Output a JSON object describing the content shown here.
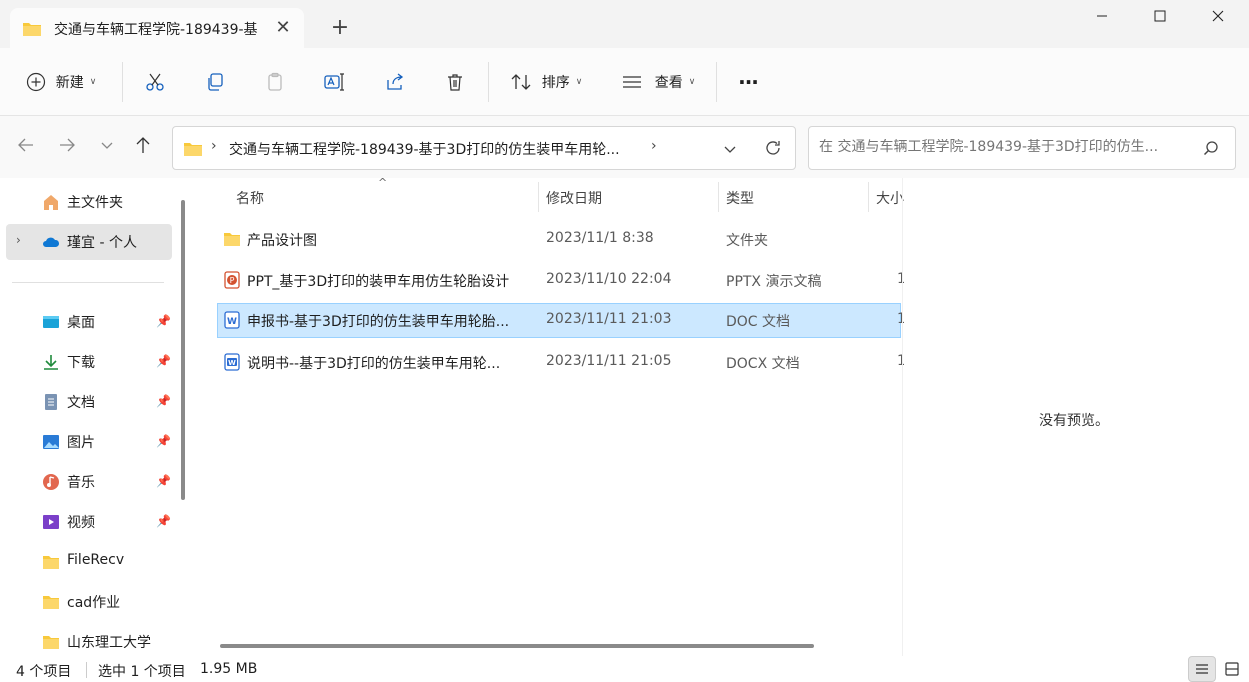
{
  "tab": {
    "title": "交通与车辆工程学院-189439-基",
    "close": "✕",
    "new_tab": "+"
  },
  "window": {
    "minimize": "—",
    "maximize": "☐",
    "close": "✕"
  },
  "toolbar": {
    "new_label": "新建",
    "sort_label": "排序",
    "view_label": "查看",
    "more_label": "···"
  },
  "address": {
    "path": "交通与车辆工程学院-189439-基于3D打印的仿生装甲车用轮...",
    "search_placeholder": "在 交通与车辆工程学院-189439-基于3D打印的仿生..."
  },
  "sidebar": {
    "items": [
      {
        "label": "主文件夹",
        "icon": "home-icon"
      },
      {
        "label": "瑾宜 - 个人",
        "icon": "onedrive-icon"
      },
      {
        "label": "桌面",
        "icon": "desktop-icon",
        "pinned": true
      },
      {
        "label": "下载",
        "icon": "download-icon",
        "pinned": true
      },
      {
        "label": "文档",
        "icon": "document-icon",
        "pinned": true
      },
      {
        "label": "图片",
        "icon": "pictures-icon",
        "pinned": true
      },
      {
        "label": "音乐",
        "icon": "music-icon",
        "pinned": true
      },
      {
        "label": "视频",
        "icon": "video-icon",
        "pinned": true
      },
      {
        "label": "FileRecv",
        "icon": "folder-icon"
      },
      {
        "label": "cad作业",
        "icon": "folder-icon"
      },
      {
        "label": "山东理工大学",
        "icon": "folder-icon"
      }
    ]
  },
  "columns": {
    "name": "名称",
    "modified": "修改日期",
    "type": "类型",
    "size": "大小"
  },
  "files": [
    {
      "name": "产品设计图",
      "modified": "2023/11/1 8:38",
      "type": "文件夹",
      "size": "",
      "icon": "folder-icon"
    },
    {
      "name": "PPT_基于3D打印的装甲车用仿生轮胎设计",
      "modified": "2023/11/10 22:04",
      "type": "PPTX 演示文稿",
      "size": "1",
      "icon": "pptx-icon"
    },
    {
      "name": "申报书-基于3D打印的仿生装甲车用轮胎...",
      "modified": "2023/11/11 21:03",
      "type": "DOC 文档",
      "size": "1",
      "icon": "doc-icon",
      "selected": true
    },
    {
      "name": "说明书--基于3D打印的仿生装甲车用轮...",
      "modified": "2023/11/11 21:05",
      "type": "DOCX 文档",
      "size": "1",
      "icon": "docx-icon"
    }
  ],
  "preview": {
    "text": "没有预览。"
  },
  "status": {
    "count": "4 个项目",
    "selection": "选中 1 个项目",
    "size": "1.95 MB"
  },
  "colors": {
    "selection": "#cce8ff",
    "accent": "#0067c0",
    "folder": "#f8c93b"
  }
}
